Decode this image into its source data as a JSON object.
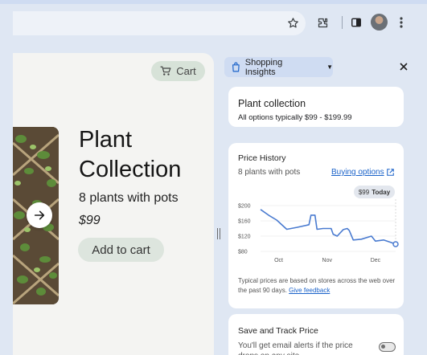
{
  "browser": {
    "icons": [
      "star-icon",
      "extensions-icon",
      "side-panel-icon",
      "avatar",
      "more-vert-icon"
    ]
  },
  "page": {
    "cart_label": "Cart",
    "product_title": "Plant Collection",
    "product_subtitle": "8 plants with pots",
    "product_price": "$99",
    "add_to_cart_label": "Add to cart"
  },
  "panel": {
    "header_label": "Shopping Insights",
    "summary": {
      "title": "Plant collection",
      "subtitle": "All options typically $99 - $199.99"
    },
    "price_history": {
      "title": "Price History",
      "subtitle": "8 plants with pots",
      "link_label": "Buying options",
      "today_price": "$99",
      "today_label": "Today",
      "note": "Typical prices are based on stores across the web over the past 90 days.",
      "feedback_label": "Give feedback"
    },
    "track": {
      "title": "Save and Track Price",
      "subtitle": "You'll get email alerts if the price drops on any site"
    },
    "accent_color": "#1a62c9",
    "line_color": "#4a7bd0"
  },
  "chart_data": {
    "type": "line",
    "x_ticks": [
      "Oct",
      "Nov",
      "Dec"
    ],
    "y_ticks": [
      "$200",
      "$160",
      "$120",
      "$80"
    ],
    "ylim": [
      80,
      200
    ],
    "series": [
      {
        "values": [
          [
            0,
            190
          ],
          [
            4,
            175
          ],
          [
            8,
            162
          ],
          [
            13,
            138
          ],
          [
            18,
            143
          ],
          [
            24,
            150
          ],
          [
            25,
            175
          ],
          [
            27,
            175
          ],
          [
            28,
            138
          ],
          [
            31,
            140
          ],
          [
            35,
            140
          ],
          [
            36,
            125
          ],
          [
            38,
            120
          ],
          [
            41,
            137
          ],
          [
            43,
            140
          ],
          [
            44,
            135
          ],
          [
            46,
            110
          ],
          [
            50,
            112
          ],
          [
            55,
            120
          ],
          [
            57,
            107
          ],
          [
            61,
            110
          ],
          [
            65,
            103
          ],
          [
            67,
            99
          ]
        ]
      }
    ],
    "x_range": [
      0,
      67
    ],
    "x_tick_positions": [
      9,
      33,
      57
    ]
  }
}
